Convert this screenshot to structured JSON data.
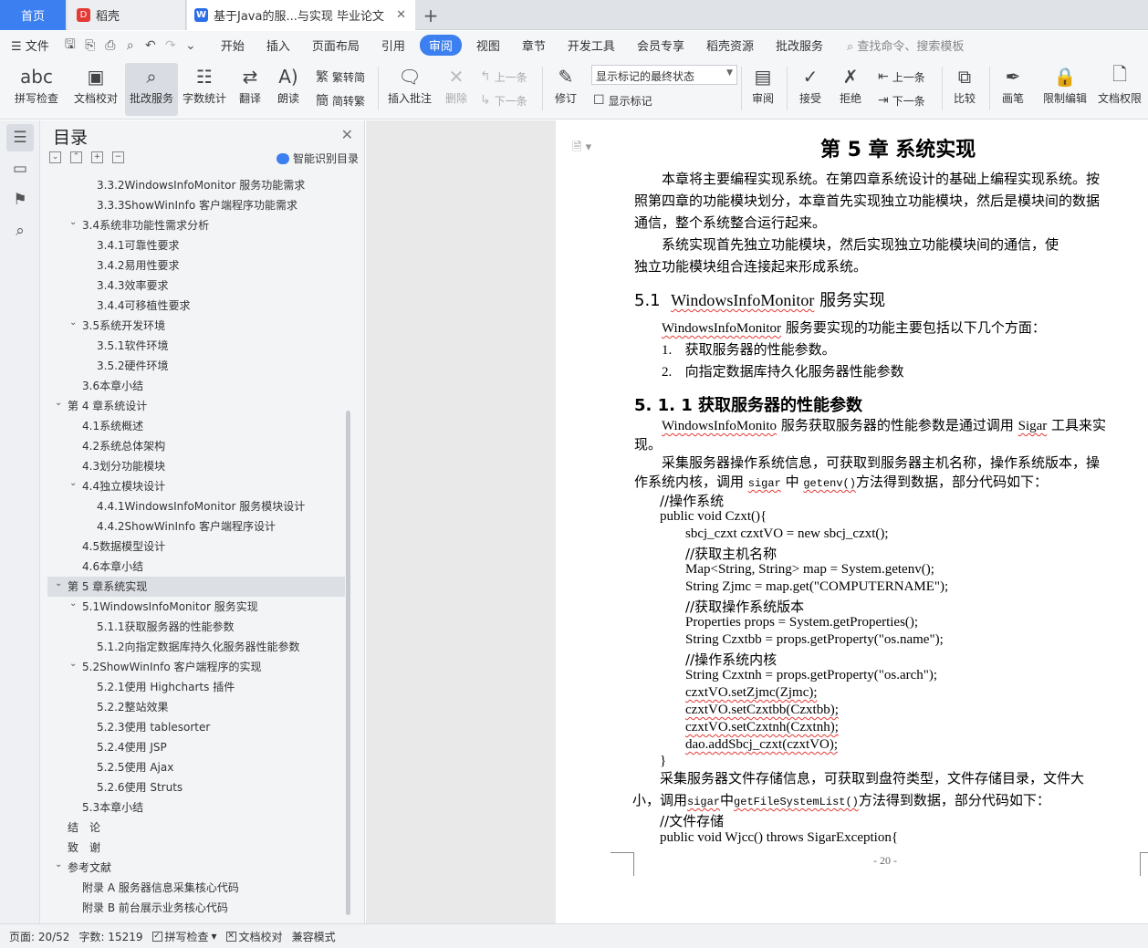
{
  "tabs": {
    "home": "首页",
    "daoke": "稻壳",
    "doc": "基于Java的服...与实现 毕业论文"
  },
  "menu": {
    "file": "文件",
    "items": [
      "开始",
      "插入",
      "页面布局",
      "引用",
      "审阅",
      "视图",
      "章节",
      "开发工具",
      "会员专享",
      "稻壳资源",
      "批改服务"
    ],
    "search": "查找命令、搜索模板"
  },
  "ribbon": {
    "spell": "拼写检查",
    "proof": "文档校对",
    "correction": "批改服务",
    "wordcount": "字数统计",
    "translate": "翻译",
    "read": "朗读",
    "to_trad": "繁转简",
    "to_simp": "简转繁",
    "insert_comment": "插入批注",
    "delete": "删除",
    "prev_comment": "上一条",
    "next_comment": "下一条",
    "revise": "修订",
    "mode": "显示标记的最终状态",
    "show_marks": "显示标记",
    "review": "审阅",
    "accept": "接受",
    "reject": "拒绝",
    "prev": "上一条",
    "next": "下一条",
    "compare": "比较",
    "pen": "画笔",
    "restrict": "限制编辑",
    "permission": "文档权限"
  },
  "toc": {
    "title": "目录",
    "ai": "智能识别目录",
    "items": [
      "3.3.2WindowsInfoMonitor 服务功能需求",
      "3.3.3ShowWinInfo 客户端程序功能需求",
      "3.4系统非功能性需求分析",
      "3.4.1可靠性要求",
      "3.4.2易用性要求",
      "3.4.3效率要求",
      "3.4.4可移植性要求",
      "3.5系统开发环境",
      "3.5.1软件环境",
      "3.5.2硬件环境",
      "3.6本章小结",
      "第 4 章系统设计",
      "4.1系统概述",
      "4.2系统总体架构",
      "4.3划分功能模块",
      "4.4独立模块设计",
      "4.4.1WindowsInfoMonitor 服务模块设计",
      "4.4.2ShowWinInfo 客户端程序设计",
      "4.5数据模型设计",
      "4.6本章小结",
      "第 5 章系统实现",
      "5.1WindowsInfoMonitor 服务实现",
      "5.1.1获取服务器的性能参数",
      "5.1.2向指定数据库持久化服务器性能参数",
      "5.2ShowWinInfo 客户端程序的实现",
      "5.2.1使用 Highcharts 插件",
      "5.2.2整站效果",
      "5.2.3使用 tablesorter",
      "5.2.4使用 JSP",
      "5.2.5使用 Ajax",
      "5.2.6使用 Struts",
      "5.3本章小结",
      "结　论",
      "致　谢",
      "参考文献",
      "附录 A 服务器信息采集核心代码",
      "附录 B 前台展示业务核心代码"
    ]
  },
  "doc": {
    "chapter": "第 5 章  系统实现",
    "p1a": "本章将主要编程实现系统。在第四章系统设计的基础上编程实现系统。按",
    "p1b": "照第四章的功能模块划分，本章首先实现独立功能模块，然后是模块间的数据",
    "p1c": "通信，整个系统整合运行起来。",
    "p2a": "系统实现首先独立功能模块，然后实现独立功能模块间的通信，使",
    "p2b": "独立功能模块组合连接起来形成系统。",
    "h51_num": "5.1",
    "h51_en": "WindowsInfoMonitor",
    "h51_zh": " 服务实现",
    "p3_en": "WindowsInfoMonitor",
    "p3_zh": " 服务要实现的功能主要包括以下几个方面：",
    "li1": "获取服务器的性能参数。",
    "li2": "向指定数据库持久化服务器性能参数",
    "h511": "5. 1. 1  获取服务器的性能参数",
    "p4_en": "WindowsInfoMonito",
    "p4_zh1": " 服务获取服务器的性能参数是通过调用 ",
    "p4_sig": "Sigar",
    "p4_zh2": " 工具来实",
    "p4b": "现。",
    "p5a": "采集服务器操作系统信息，可获取到服务器主机名称，操作系统版本，操",
    "p5b_1": "作系统内核，调用 ",
    "p5b_sig": "sigar",
    "p5b_2": " 中 ",
    "p5b_fn": "getenv()",
    "p5b_3": "方法得到数据，部分代码如下：",
    "c_os": "//操作系统",
    "c1": "public void Czxt(){",
    "c2": "sbcj_czxt czxtVO = new sbcj_czxt();",
    "c3": "//获取主机名称",
    "c4": "Map<String, String> map = System.getenv();",
    "c5": "String Zjmc = map.get(\"COMPUTERNAME\");",
    "c6": "//获取操作系统版本",
    "c7": "Properties props = System.getProperties();",
    "c8": "String Czxtbb = props.getProperty(\"os.name\");",
    "c9": "//操作系统内核",
    "c10": "String Czxtnh = props.getProperty(\"os.arch\");",
    "c11": "czxtVO.setZjmc(Zjmc);",
    "c12": "czxtVO.setCzxtbb(Czxtbb);",
    "c13": "czxtVO.setCzxtnh(Czxtnh);",
    "c14": "dao.addSbcj_czxt(czxtVO);",
    "c15": "}",
    "p6a": "采集服务器文件存储信息，可获取到盘符类型，文件存储目录，文件大",
    "p6b_1": "小，调用",
    "p6b_sig": "sigar",
    "p6b_2": "中",
    "p6b_fn": "getFileSystemList()",
    "p6b_3": "方法得到数据，部分代码如下：",
    "c16": "//文件存储",
    "c17": "public void Wjcc() throws SigarException{",
    "page_num": "- 20 -"
  },
  "status": {
    "page": "页面: 20/52",
    "words": "字数: 15219",
    "spell": "拼写检查",
    "proof": "文档校对",
    "compat": "兼容模式"
  }
}
